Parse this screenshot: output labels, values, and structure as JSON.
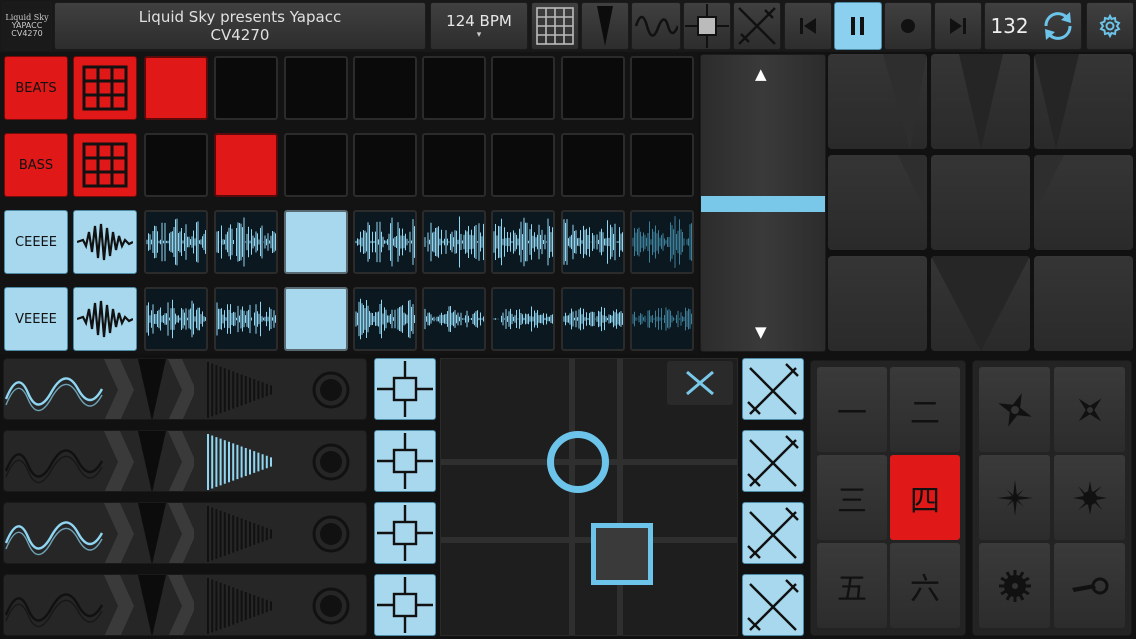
{
  "header": {
    "logo_text_1": "Liquid Sky",
    "logo_text_2": "YAPACC",
    "logo_text_3": "CV4270",
    "title_line1": "Liquid Sky presents Yapacc",
    "title_line2": "CV4270",
    "bpm_label": "124 BPM",
    "bpm_arrow": "▾",
    "bar_count": "132"
  },
  "tracks": [
    {
      "name": "BEATS",
      "type": "drum",
      "color": "#e01818",
      "pattern": [
        "on",
        "off",
        "off",
        "off",
        "off",
        "off",
        "off",
        "off"
      ]
    },
    {
      "name": "BASS",
      "type": "drum",
      "color": "#e01818",
      "pattern": [
        "off",
        "on",
        "off",
        "off",
        "off",
        "off",
        "off",
        "off"
      ]
    },
    {
      "name": "CEEEE",
      "type": "wave",
      "color": "#a7d8ee",
      "pattern": [
        "wave",
        "wave",
        "on",
        "wave",
        "wave",
        "wave",
        "wave",
        "wave-dim"
      ]
    },
    {
      "name": "VEEEE",
      "type": "wave",
      "color": "#a7d8ee",
      "pattern": [
        "wave",
        "wave",
        "on",
        "wave",
        "wave",
        "wave",
        "wave",
        "wave-dim"
      ]
    }
  ],
  "slider": {
    "up_arrow": "▲",
    "down_arrow": "▼",
    "level_fraction": 0.5
  },
  "kanji_pads": [
    "一",
    "二",
    "三",
    "四",
    "五",
    "六"
  ],
  "kanji_active": "四",
  "colors": {
    "accent_blue": "#5ab8e0",
    "accent_red": "#e01818"
  }
}
